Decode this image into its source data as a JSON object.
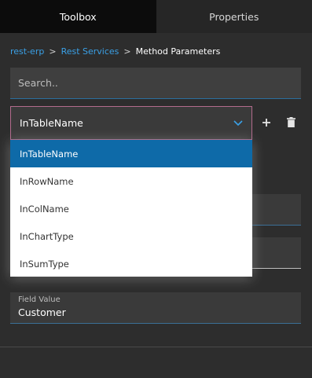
{
  "tabs": [
    {
      "label": "Toolbox",
      "active": true
    },
    {
      "label": "Properties",
      "active": false
    }
  ],
  "breadcrumb": {
    "items": [
      "rest-erp",
      "Rest Services"
    ],
    "separator": ">",
    "current": "Method Parameters"
  },
  "search": {
    "placeholder": "Search..",
    "value": ""
  },
  "parameter_select": {
    "selected": "InTableName",
    "options": [
      "InTableName",
      "InRowName",
      "InColName",
      "InChartType",
      "InSumType"
    ]
  },
  "field_value": {
    "label": "Field Value",
    "value": "Customer"
  },
  "icons": {
    "chevron": "chevron-down-icon",
    "add": "plus-icon",
    "delete": "trash-icon"
  },
  "colors": {
    "accent": "#0e6aa8",
    "link": "#3aa0e6",
    "focus_border": "#b26b8d",
    "background": "#2d2d2d"
  }
}
